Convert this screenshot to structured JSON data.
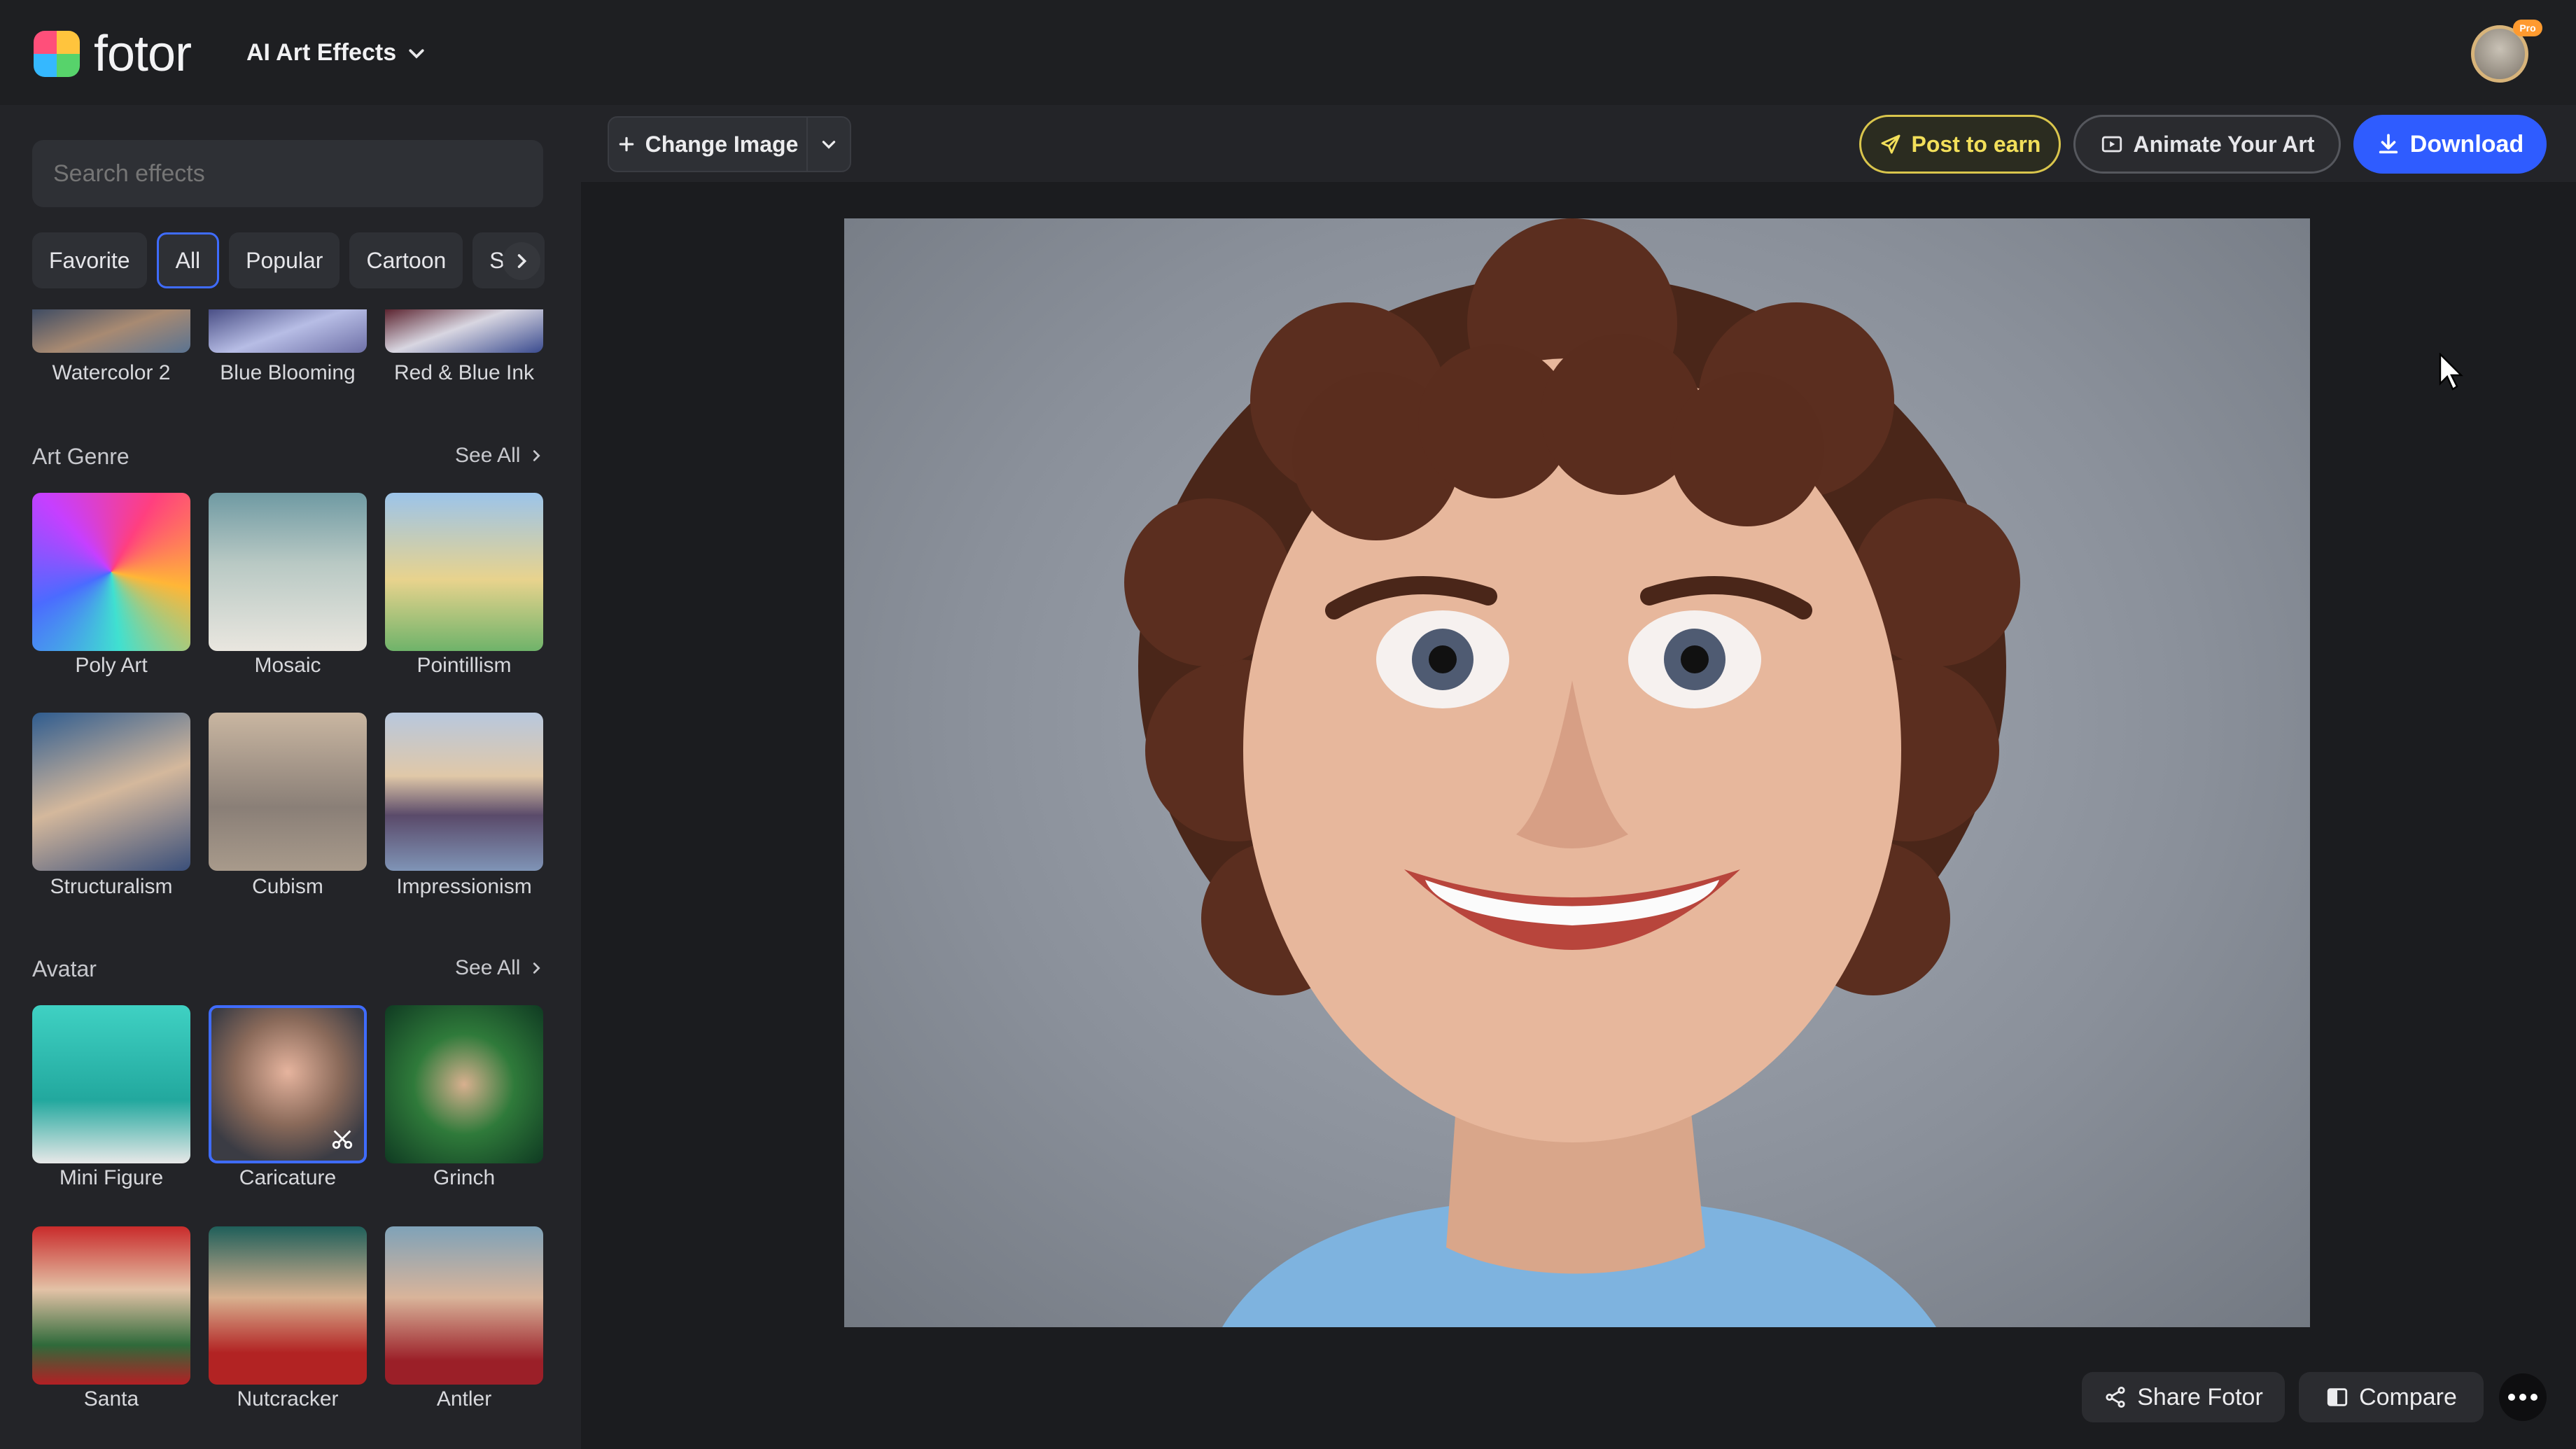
{
  "header": {
    "logo_text": "fotor",
    "menu_label": "AI Art Effects",
    "avatar_badge": "Pro"
  },
  "sidebar": {
    "search_placeholder": "Search effects",
    "tabs": [
      {
        "label": "Favorite"
      },
      {
        "label": "All"
      },
      {
        "label": "Popular"
      },
      {
        "label": "Cartoon"
      },
      {
        "label": "Ske"
      }
    ],
    "top_row": [
      {
        "label": "Watercolor 2"
      },
      {
        "label": "Blue Blooming"
      },
      {
        "label": "Red & Blue Ink"
      }
    ],
    "art_genre": {
      "title": "Art Genre",
      "see_all": "See All",
      "items": [
        {
          "label": "Poly Art"
        },
        {
          "label": "Mosaic"
        },
        {
          "label": "Pointillism"
        },
        {
          "label": "Structuralism"
        },
        {
          "label": "Cubism"
        },
        {
          "label": "Impressionism"
        }
      ]
    },
    "avatar": {
      "title": "Avatar",
      "see_all": "See All",
      "items": [
        {
          "label": "Mini Figure"
        },
        {
          "label": "Caricature"
        },
        {
          "label": "Grinch"
        },
        {
          "label": "Santa"
        },
        {
          "label": "Nutcracker"
        },
        {
          "label": "Antler"
        }
      ]
    }
  },
  "toolbar": {
    "change_image": "Change Image",
    "post_to_earn": "Post to earn",
    "animate": "Animate Your Art",
    "download": "Download"
  },
  "footer": {
    "share": "Share Fotor",
    "compare": "Compare"
  },
  "colors": {
    "accent": "#2f5cff",
    "post_gold": "#f2df5a",
    "panel": "#232428",
    "background": "#1b1c1f"
  }
}
